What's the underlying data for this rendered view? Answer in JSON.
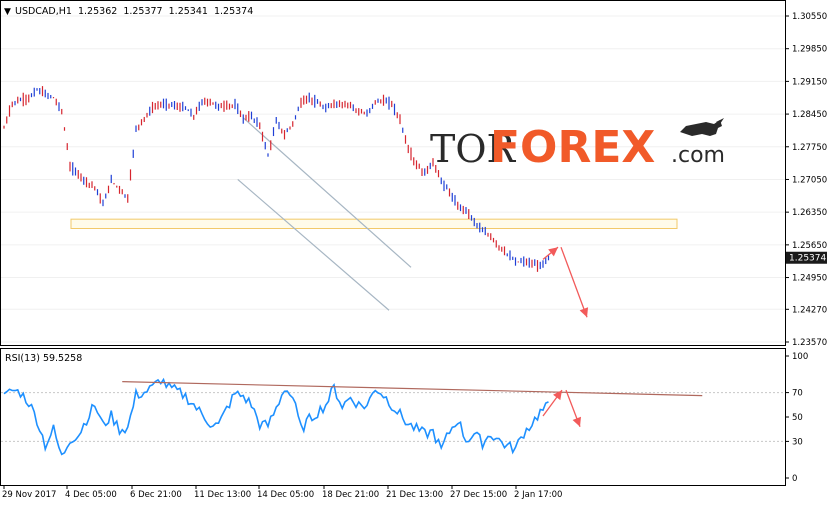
{
  "header": {
    "symbol_line": "USDCAD,H1  1.25362  1.25377  1.25341  1.25374"
  },
  "watermark": {
    "tor": "TOR",
    "forex": "FOREX",
    "com": ".com"
  },
  "colors": {
    "bull": "#1f3fd6",
    "bear": "#d6252e",
    "rsi": "#1e90ff",
    "channel": "#a7b6c3",
    "zone_border": "#f2c96a",
    "zone_fill": "#fffbe9",
    "arrow": "#f25a5a",
    "rsi_trend": "#b0695e",
    "price_tag_bg": "#1a1a1a",
    "forex_orange": "#f15a29"
  },
  "chart_data": [
    {
      "type": "candlestick",
      "symbol": "USDCAD",
      "timeframe": "H1",
      "ohlc_last": {
        "open": 1.25362,
        "high": 1.25377,
        "low": 1.25341,
        "close": 1.25374
      },
      "current_price_label": "1.25374",
      "y_ticks": [
        "1.30550",
        "1.29850",
        "1.29150",
        "1.28450",
        "1.27750",
        "1.27050",
        "1.26350",
        "1.25650",
        "1.24950",
        "1.24270",
        "1.23570"
      ],
      "ylim": [
        1.2357,
        1.3055
      ],
      "x_ticks": [
        "29 Nov 2017",
        "4 Dec 05:00",
        "6 Dec 21:00",
        "11 Dec 13:00",
        "14 Dec 05:00",
        "18 Dec 21:00",
        "21 Dec 13:00",
        "27 Dec 15:00",
        "2 Jan 17:00"
      ],
      "x": [
        0,
        3,
        6,
        9,
        12,
        15,
        18,
        21,
        24,
        27,
        30,
        33,
        36,
        39,
        42,
        45,
        48,
        51,
        54,
        57,
        60,
        63,
        66,
        69,
        72,
        75,
        78,
        81,
        84,
        87,
        90,
        93,
        96,
        99,
        102,
        105,
        108,
        111,
        114,
        117,
        120,
        123,
        126,
        129,
        132,
        135,
        138,
        141,
        144,
        147,
        150,
        153,
        156,
        159,
        162,
        165,
        168,
        171,
        174,
        177,
        180,
        183,
        186,
        189,
        192,
        195,
        198
      ],
      "close": [
        1.2815,
        1.2868,
        1.2875,
        1.2879,
        1.2897,
        1.2888,
        1.288,
        1.2852,
        1.2733,
        1.2716,
        1.27,
        1.2689,
        1.2652,
        1.2703,
        1.2685,
        1.2664,
        1.2812,
        1.2836,
        1.2858,
        1.2866,
        1.2866,
        1.2861,
        1.2858,
        1.284,
        1.2871,
        1.2871,
        1.2861,
        1.2863,
        1.2864,
        1.2836,
        1.284,
        1.282,
        1.2756,
        1.283,
        1.28,
        1.2825,
        1.2869,
        1.288,
        1.2868,
        1.2856,
        1.2868,
        1.2865,
        1.2866,
        1.2849,
        1.2845,
        1.2872,
        1.2873,
        1.2867,
        1.2833,
        1.2769,
        1.2736,
        1.2718,
        1.2742,
        1.2702,
        1.2678,
        1.2647,
        1.264,
        1.2615,
        1.2595,
        1.2582,
        1.2561,
        1.2546,
        1.2528,
        1.253,
        1.2524,
        1.252,
        1.2537
      ],
      "channel": {
        "upper": [
          [
            87,
            1.2837
          ],
          [
            132,
            1.265
          ],
          [
            148,
            1.2517
          ]
        ],
        "lower": [
          [
            85,
            1.2705
          ],
          [
            118,
            1.2511
          ],
          [
            140,
            1.2425
          ]
        ]
      },
      "support_zone": [
        1.26,
        1.262
      ],
      "forecast_path": [
        [
          1.2534,
          1.256
        ],
        [
          1.256,
          1.241
        ]
      ]
    },
    {
      "type": "line",
      "indicator": "RSI(13)",
      "label": "RSI(13) 59.5258",
      "value_last": 59.5258,
      "y_ticks": [
        "100",
        "70",
        "50",
        "30",
        "0"
      ],
      "ylim": [
        0,
        100
      ],
      "x": [
        0,
        3,
        6,
        9,
        12,
        15,
        18,
        21,
        24,
        27,
        30,
        33,
        36,
        39,
        42,
        45,
        48,
        51,
        54,
        57,
        60,
        63,
        66,
        69,
        72,
        75,
        78,
        81,
        84,
        87,
        90,
        93,
        96,
        99,
        102,
        105,
        108,
        111,
        114,
        117,
        120,
        123,
        126,
        129,
        132,
        135,
        138,
        141,
        144,
        147,
        150,
        153,
        156,
        159,
        162,
        165,
        168,
        171,
        174,
        177,
        180,
        183,
        186,
        189,
        192,
        195,
        198
      ],
      "values": [
        66,
        72,
        70,
        62,
        48,
        27,
        40,
        17,
        32,
        35,
        48,
        60,
        43,
        51,
        40,
        41,
        68,
        70,
        74,
        81,
        74,
        71,
        67,
        60,
        52,
        45,
        43,
        57,
        69,
        67,
        60,
        44,
        43,
        57,
        74,
        66,
        40,
        48,
        54,
        60,
        74,
        59,
        66,
        60,
        59,
        74,
        68,
        60,
        52,
        44,
        40,
        36,
        38,
        23,
        38,
        48,
        31,
        36,
        29,
        36,
        31,
        26,
        24,
        37,
        45,
        54,
        59
      ],
      "trendline": [
        [
          43,
          79
        ],
        [
          203,
          70
        ]
      ],
      "forecast_path": [
        [
          59,
          72
        ],
        [
          72,
          42
        ]
      ]
    }
  ]
}
